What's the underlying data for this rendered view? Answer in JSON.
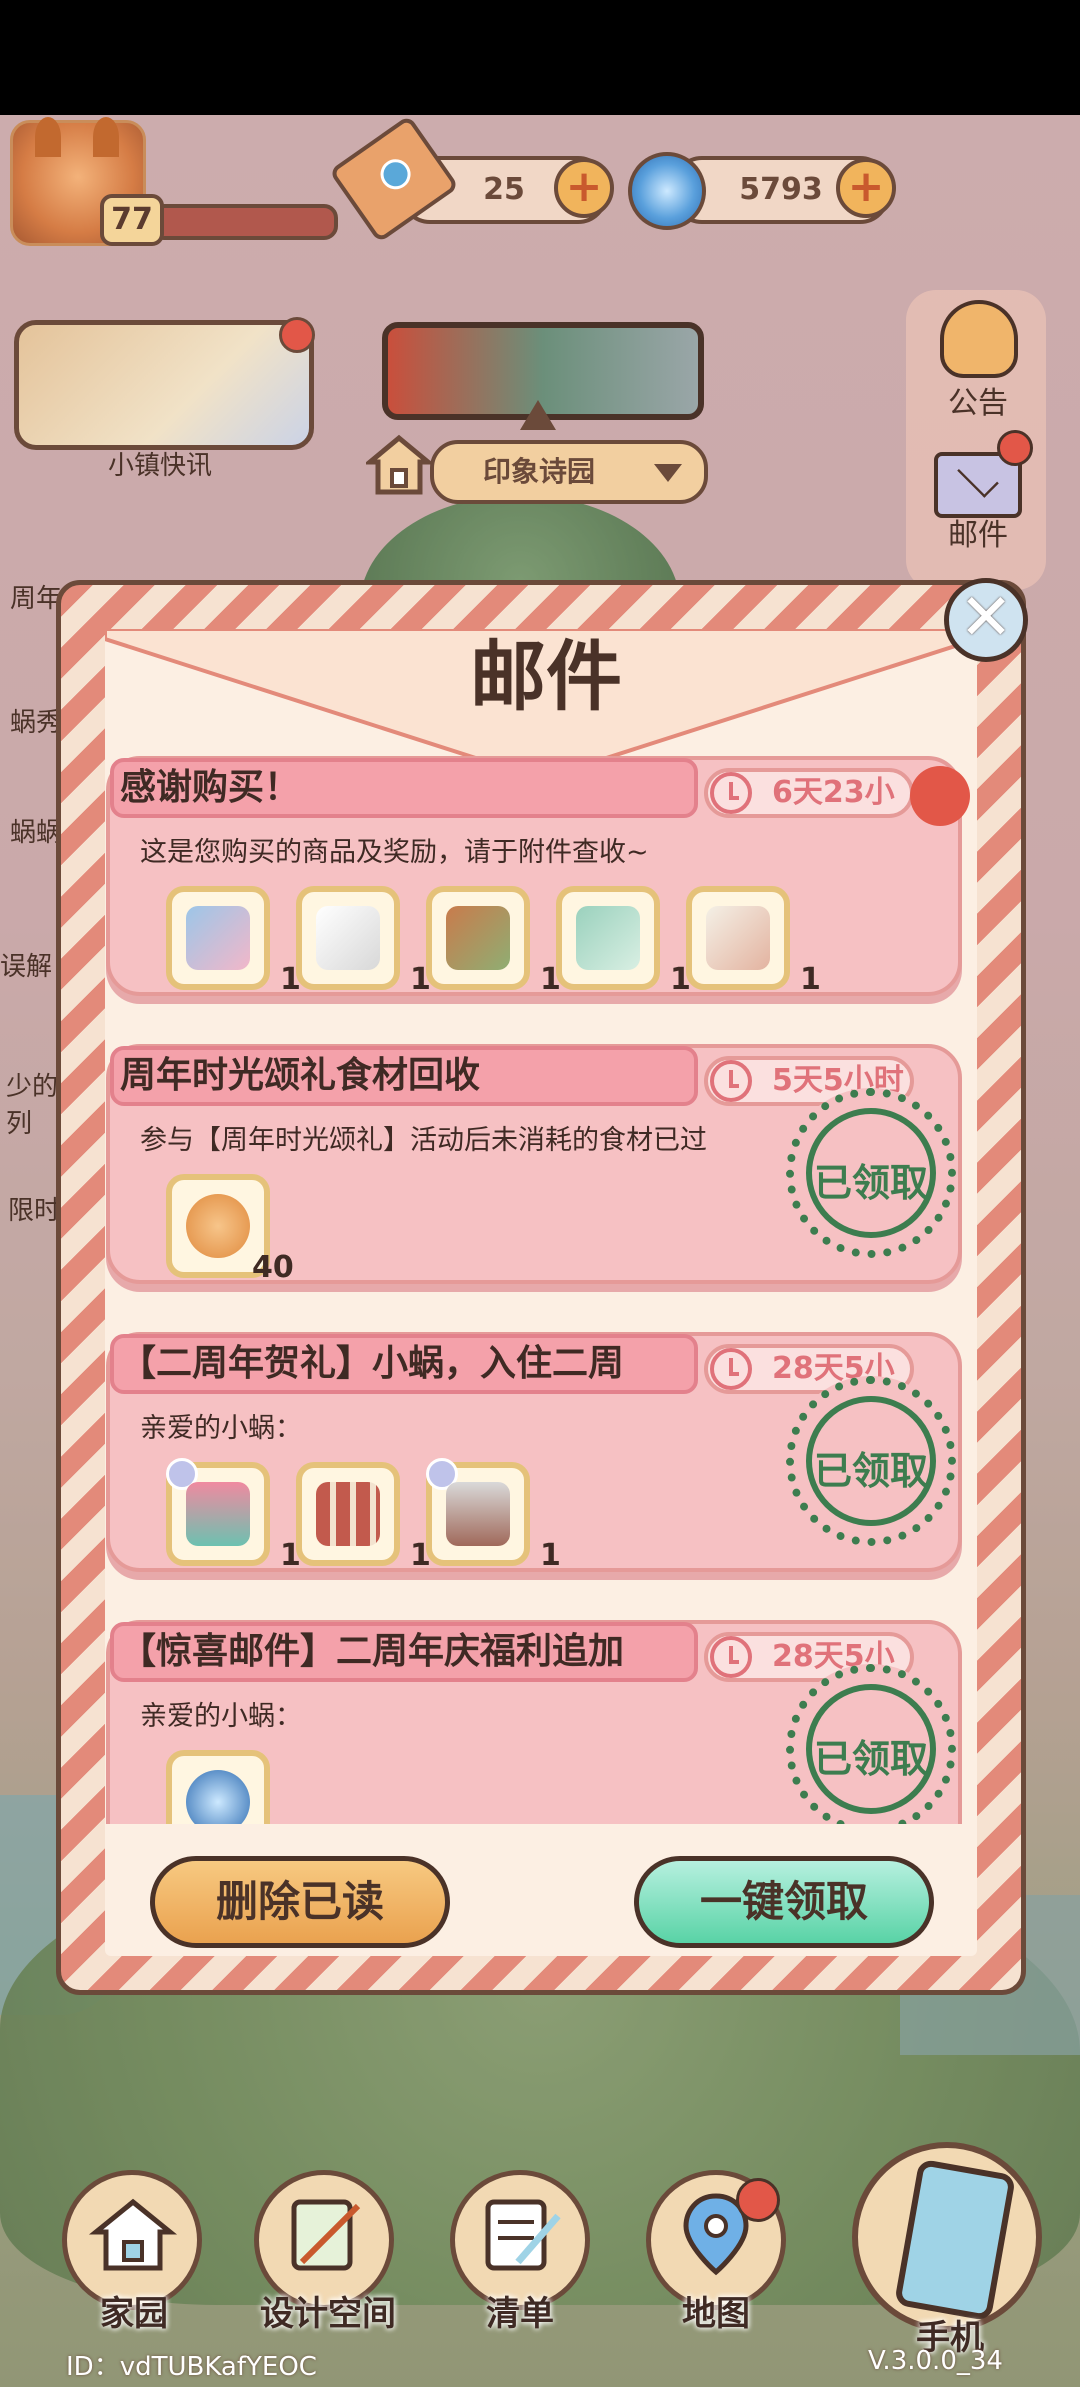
{
  "hud": {
    "level": "77",
    "tickets": "25",
    "currency": "5793"
  },
  "left_menu": {
    "news_label": "小镇快讯",
    "items": [
      "周年",
      "蜗秀",
      "蜗蜗",
      "误解",
      "少的列",
      "限时"
    ]
  },
  "location": {
    "name": "印象诗园"
  },
  "right_menu": {
    "notice_label": "公告",
    "mail_label": "邮件"
  },
  "modal": {
    "title": "邮件",
    "mails": [
      {
        "title": "感谢购买！",
        "time": "6天23小",
        "body": "这是您购买的商品及奖励，请于附件查收~",
        "items": [
          {
            "icon": "dress-icon",
            "qty": "1"
          },
          {
            "icon": "hair-icon",
            "qty": "1"
          },
          {
            "icon": "hat-icon",
            "qty": "1"
          },
          {
            "icon": "shorts-icon",
            "qty": "1"
          },
          {
            "icon": "socks-icon",
            "qty": "1"
          }
        ],
        "claimed_label": ""
      },
      {
        "title": "周年时光颂礼食材回收",
        "time": "5天5小时",
        "body": "参与【周年时光颂礼】活动后未消耗的食材已过",
        "items": [
          {
            "icon": "coin-icon",
            "qty": "40"
          }
        ],
        "claimed_label": "已领取"
      },
      {
        "title": "【二周年贺礼】小蜗，入住二周",
        "time": "28天5小",
        "body": "亲爱的小蜗：",
        "items": [
          {
            "icon": "cake-icon",
            "qty": "1"
          },
          {
            "icon": "photo-wall-icon",
            "qty": "1"
          },
          {
            "icon": "furniture-icon",
            "qty": "1"
          }
        ],
        "claimed_label": "已领取"
      },
      {
        "title": "【惊喜邮件】二周年庆福利追加",
        "time": "28天5小",
        "body": "亲爱的小蜗：",
        "items": [
          {
            "icon": "swirl-icon",
            "qty": ""
          }
        ],
        "claimed_label": "已领取"
      }
    ],
    "delete_read_label": "删除已读",
    "collect_all_label": "一键领取"
  },
  "bottom_nav": {
    "home": "家园",
    "design": "设计空间",
    "list": "清单",
    "map": "地图",
    "phone": "手机"
  },
  "footer": {
    "id": "ID：vdTUBKafYEOC",
    "version": "V.3.0.0_34"
  },
  "colors": {
    "accent_red": "#e25748",
    "card_pink": "#f6c1c3",
    "stamp_green": "#3d7d4f",
    "collect_green": "#59d3a6",
    "delete_orange": "#eaa24f"
  }
}
